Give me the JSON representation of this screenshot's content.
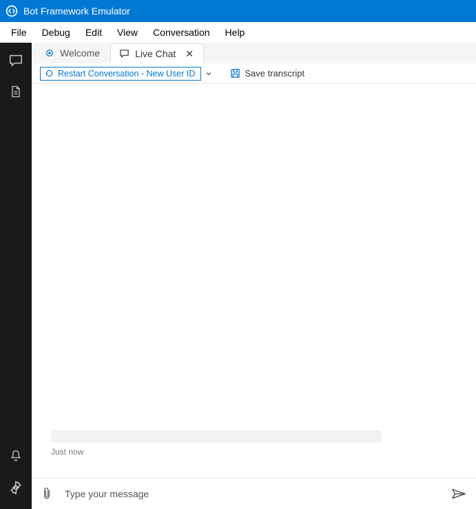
{
  "app": {
    "title": "Bot Framework Emulator"
  },
  "menu": {
    "items": [
      "File",
      "Debug",
      "Edit",
      "View",
      "Conversation",
      "Help"
    ]
  },
  "tabs": {
    "welcome_label": "Welcome",
    "livechat_label": "Live Chat"
  },
  "toolbar": {
    "restart_label": "Restart Conversation - New User ID",
    "save_label": "Save transcript"
  },
  "chat": {
    "timestamp": "Just now"
  },
  "input": {
    "placeholder": "Type your message"
  }
}
